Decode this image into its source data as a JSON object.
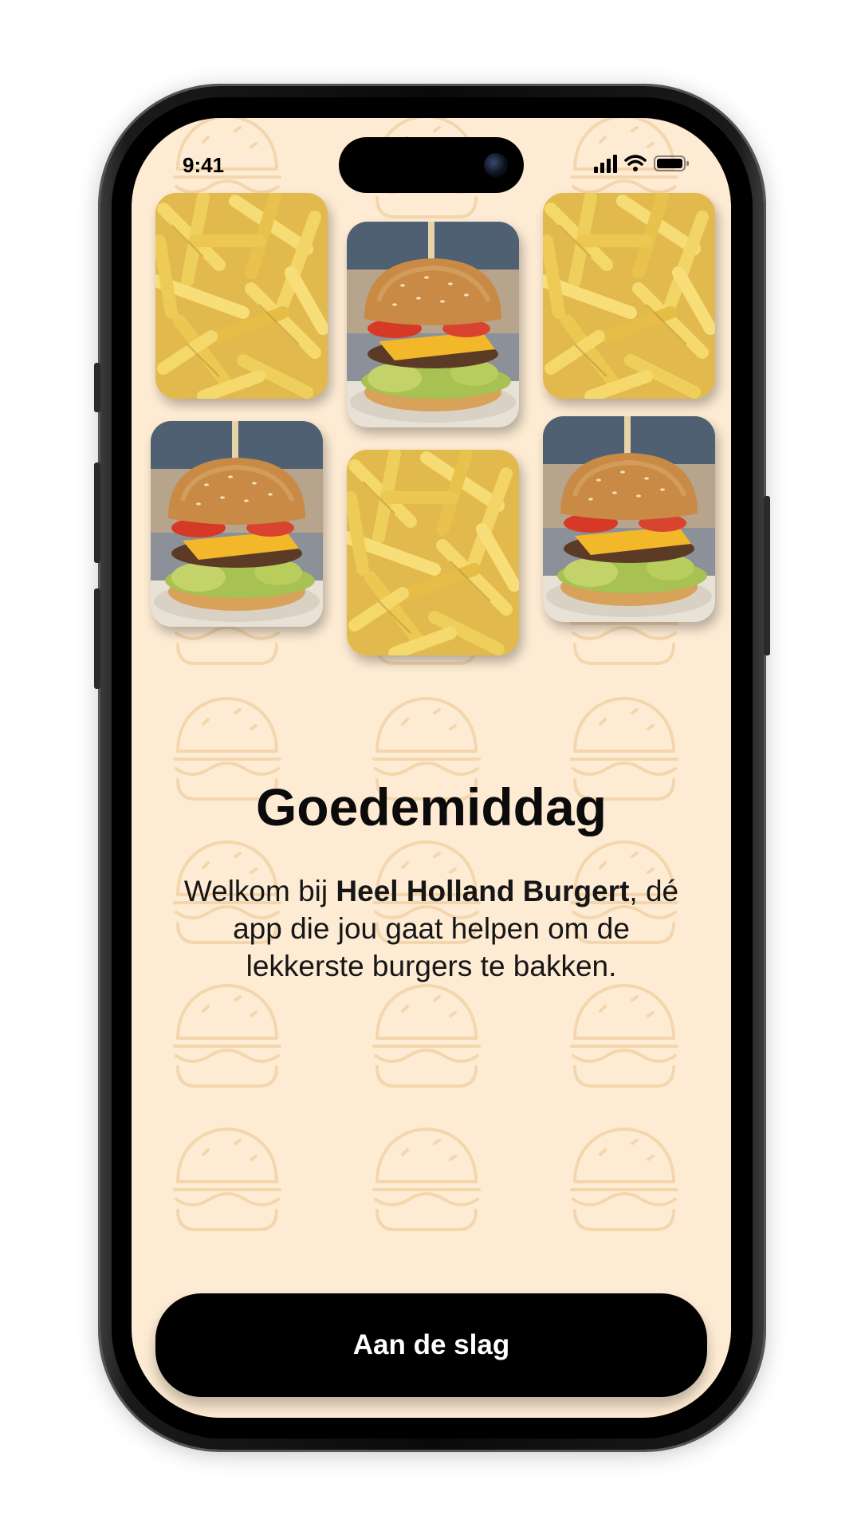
{
  "status_bar": {
    "time": "9:41",
    "icons": [
      "cellular-signal-icon",
      "wifi-icon",
      "battery-icon"
    ]
  },
  "gallery": {
    "tiles": [
      {
        "subject": "fries"
      },
      {
        "subject": "burger"
      },
      {
        "subject": "fries"
      },
      {
        "subject": "burger"
      },
      {
        "subject": "fries"
      },
      {
        "subject": "burger"
      }
    ]
  },
  "welcome": {
    "title": "Goedemiddag",
    "intro_prefix": "Welkom bij ",
    "app_name": "Heel Holland Burgert",
    "intro_suffix": ", dé app die jou gaat helpen om de lekkerste burgers te bakken."
  },
  "cta": {
    "label": "Aan de slag"
  },
  "colors": {
    "background": "#fdebd3",
    "pattern": "#f6d9b1",
    "button": "#000000",
    "button_text": "#ffffff"
  }
}
